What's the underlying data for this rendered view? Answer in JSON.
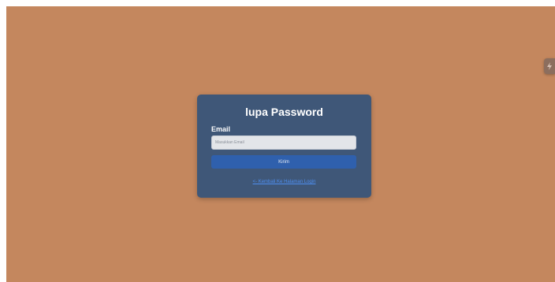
{
  "form": {
    "title": "lupa Password",
    "email_label": "Email",
    "email_placeholder": "Masukkan Email",
    "email_value": "",
    "submit_label": "Kirim",
    "back_link_label": "<- Kembali Ke Halaman Login"
  },
  "colors": {
    "page_background": "#c4875e",
    "card_background": "#3f5778",
    "button_background": "#2f60ad",
    "link": "#4d8ff2"
  },
  "icons": {
    "side_widget": "lightning-icon"
  }
}
